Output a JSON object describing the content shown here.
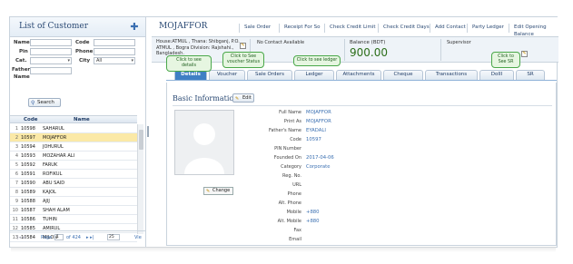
{
  "left": {
    "title": "List of Customer",
    "add_icon": "plus-icon",
    "form": {
      "name_label": "Name",
      "code_label": "Code",
      "pin_label": "Pin",
      "phone_label": "Phone",
      "cat_label": "Cat.",
      "city_label": "City",
      "city_value": "All",
      "father_label": "Father",
      "name2_label": "Name",
      "search_label": "Search"
    },
    "grid": {
      "headers": {
        "code": "Code",
        "name": "Name"
      },
      "rows": [
        {
          "num": "1",
          "code": "10598",
          "name": "SAHARUL"
        },
        {
          "num": "2",
          "code": "10597",
          "name": "MOJAFFOR"
        },
        {
          "num": "3",
          "code": "10594",
          "name": "JOHURUL"
        },
        {
          "num": "4",
          "code": "10593",
          "name": "MOZAHAR ALI"
        },
        {
          "num": "5",
          "code": "10592",
          "name": "FARUK"
        },
        {
          "num": "6",
          "code": "10591",
          "name": "ROFIKUL"
        },
        {
          "num": "7",
          "code": "10590",
          "name": "ABU SAID"
        },
        {
          "num": "8",
          "code": "10589",
          "name": "KAJOL"
        },
        {
          "num": "9",
          "code": "10588",
          "name": "AJIJ"
        },
        {
          "num": "10",
          "code": "10587",
          "name": "SHAH ALAM"
        },
        {
          "num": "11",
          "code": "10586",
          "name": "TUHIN"
        },
        {
          "num": "12",
          "code": "10585",
          "name": "AMIRUL"
        },
        {
          "num": "13",
          "code": "10584",
          "name": "MILON"
        }
      ]
    },
    "pager": {
      "prev": "|◂ ◂",
      "page_label": "Page",
      "page_value": "1",
      "of_label": "of 424",
      "next": "▸ ▸|",
      "per_page": "25",
      "view_label": "Vie"
    }
  },
  "right": {
    "customer_name": "MOJAFFOR",
    "toolbar": [
      "Sale Order",
      "Receipt For So",
      "Check Credit Limit",
      "Check Credit Days",
      "Add Contact",
      "Party Ledger",
      "Edit Opening Balance"
    ],
    "address": "House:ATMUL , Thana: Shibganj, P.O. ATMUL , Bogra Division: Rajshahi., Bangladesh.",
    "no_contact": "No Contact Available",
    "balance_label": "Balance (BDT)",
    "balance_value": "900.00",
    "supervisor_label": "Supervisor",
    "tabs": [
      "Details",
      "Voucher",
      "Sale Orders",
      "Ledger",
      "Attachments",
      "Cheque",
      "Transactions",
      "DoIII",
      "SR"
    ],
    "callouts": {
      "details": "Click to see details",
      "voucher": "Click to See voucher Status",
      "ledger": "Click to see ledger",
      "sr": "Click to See SR"
    },
    "basic_info_title": "Basic Information",
    "edit_label": "Edit",
    "change_label": "Change",
    "fields": [
      {
        "label": "Full Name",
        "value": "MOJAFFOR"
      },
      {
        "label": "Print As",
        "value": "MOJAFFOR"
      },
      {
        "label": "Father's Name",
        "value": "EYADALI"
      },
      {
        "label": "Code",
        "value": "10597"
      },
      {
        "label": "PIN Number",
        "value": ""
      },
      {
        "label": "Founded On",
        "value": "2017-04-06"
      },
      {
        "label": "Category",
        "value": "Corporate"
      },
      {
        "label": "Reg. No.",
        "value": ""
      },
      {
        "label": "URL",
        "value": ""
      },
      {
        "label": "Phone",
        "value": ""
      },
      {
        "label": "Alt. Phone",
        "value": ""
      },
      {
        "label": "Mobile",
        "value": "+880"
      },
      {
        "label": "Alt. Mobile",
        "value": "+880"
      },
      {
        "label": "Fax",
        "value": ""
      },
      {
        "label": "Email",
        "value": ""
      }
    ]
  },
  "colors": {
    "accent": "#3f7fc4",
    "balance": "#2c6e1a",
    "selected_row": "#fbe9a7",
    "callout_border": "#4aa84a"
  }
}
